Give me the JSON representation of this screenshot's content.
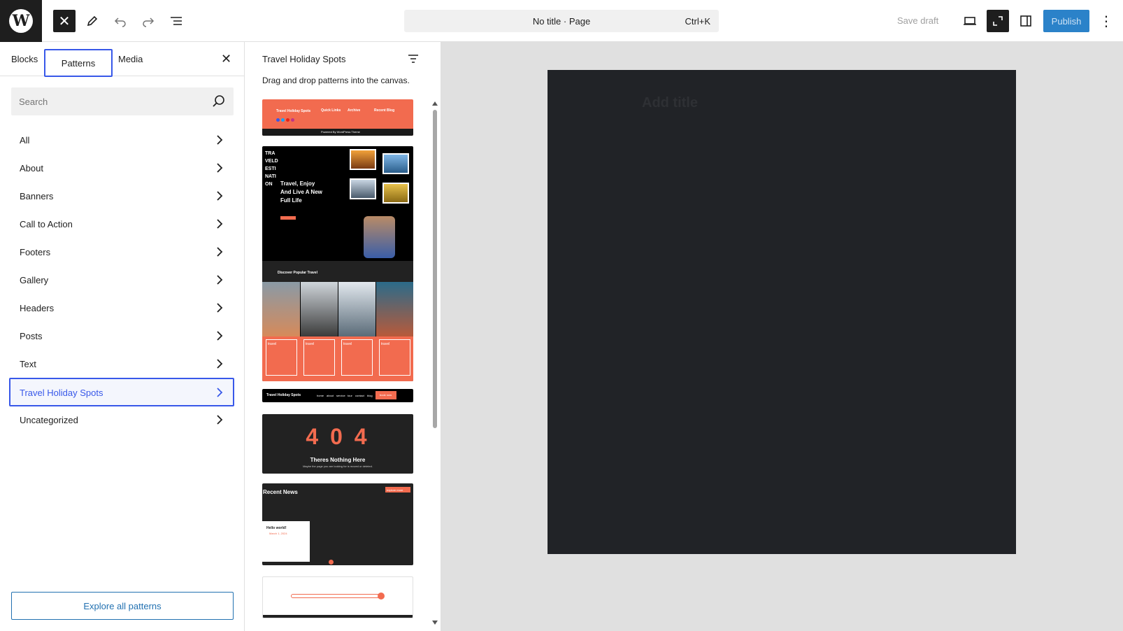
{
  "topbar": {
    "cmd_title": "No title · Page",
    "cmd_shortcut": "Ctrl+K",
    "save_draft": "Save draft",
    "publish": "Publish"
  },
  "sidebar": {
    "tabs": [
      "Blocks",
      "Patterns",
      "Media"
    ],
    "search_placeholder": "Search",
    "categories": [
      "All",
      "About",
      "Banners",
      "Call to Action",
      "Footers",
      "Gallery",
      "Headers",
      "Posts",
      "Text",
      "Travel Holiday Spots",
      "Uncategorized"
    ],
    "selected_category": "Travel Holiday Spots",
    "explore_button": "Explore all patterns"
  },
  "pattern_panel": {
    "title": "Travel Holiday Spots",
    "description": "Drag and drop patterns into the canvas.",
    "previews": {
      "footer": {
        "brand": "Travel Holiday Spots",
        "cols": [
          "Quick Links",
          "Archive",
          "Recent Blog"
        ],
        "copyright": "Powered By WordPress Theme"
      },
      "hero": {
        "vertical": [
          "TRA",
          "VELD",
          "ESTI",
          "NATI",
          "ON"
        ],
        "headline": [
          "Travel, Enjoy",
          "And Live A New",
          "Full Life"
        ],
        "section": "Discover Popular Travel",
        "card_label": "travel"
      },
      "header": {
        "brand": "Travel Holiday Spots",
        "nav": [
          "home",
          "about",
          "service",
          "tour",
          "contact",
          "blog"
        ],
        "cta": "book now"
      },
      "notfound": {
        "code": "4 0 4",
        "title": "Theres Nothing Here",
        "sub": "Maybe the page you are looking for is moved or deleted."
      },
      "news": {
        "title": "Recent News",
        "cta": "explore more",
        "card_title": "Hello world!",
        "card_date": "March 1, 2024"
      }
    }
  },
  "editor": {
    "add_title": "Add title"
  },
  "colors": {
    "accent": "#3858e9",
    "coral": "#f26b4f",
    "canvas_dark": "#212327"
  }
}
